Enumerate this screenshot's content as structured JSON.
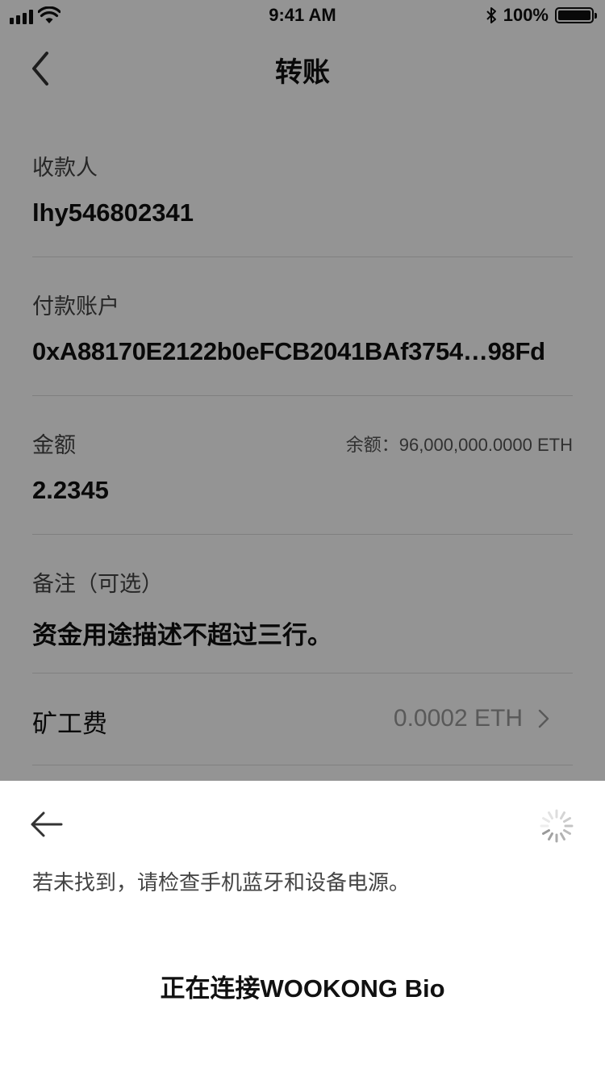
{
  "status_bar": {
    "time": "9:41 AM",
    "battery": "100%"
  },
  "header": {
    "title": "转账"
  },
  "form": {
    "payee_label": "收款人",
    "payee_value": "lhy546802341",
    "payer_label": "付款账户",
    "payer_value": "0xA88170E2122b0eFCB2041BAf3754…98Fd",
    "amount_label": "金额",
    "balance": "余额：96,000,000.0000 ETH",
    "amount_value": "2.2345",
    "memo_label": "备注（可选）",
    "memo_value": "资金用途描述不超过三行。",
    "fee_label": "矿工费",
    "fee_value": "0.0002 ETH"
  },
  "sheet": {
    "hint": "若未找到，请检查手机蓝牙和设备电源。",
    "connecting": "正在连接WOOKONG Bio"
  },
  "colors": {
    "overlay": "rgba(0,0,0,0.42)",
    "text": "#111111",
    "muted": "#999999"
  },
  "icons": [
    "signal-icon",
    "wifi-icon",
    "bluetooth-icon",
    "battery-icon",
    "back-chevron-icon",
    "chevron-right-icon",
    "arrow-left-icon",
    "loading-spinner-icon"
  ]
}
